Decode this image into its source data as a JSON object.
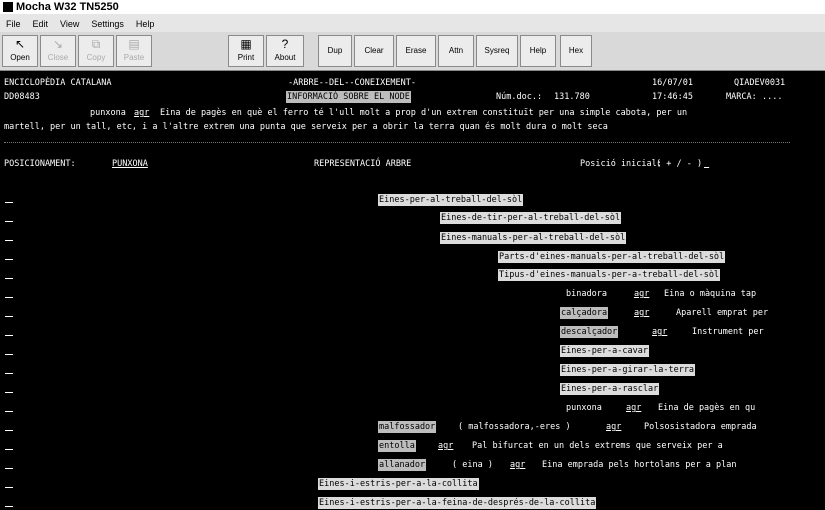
{
  "window": {
    "title": "Mocha W32 TN5250"
  },
  "menu": [
    "File",
    "Edit",
    "View",
    "Settings",
    "Help"
  ],
  "toolbar": {
    "open": "Open",
    "close": "Close",
    "copy": "Copy",
    "paste": "Paste",
    "print": "Print",
    "about": "About",
    "dup": "Dup",
    "clear": "Clear",
    "erase": "Erase",
    "attn": "Attn",
    "sysreq": "Sysreq",
    "help": "Help",
    "hex": "Hex"
  },
  "screen": {
    "header_left": "ENCICLOPÈDIA CATALANA",
    "header_center": "-ARBRE--DEL--CONEIXEMENT-",
    "header_date": "16/07/01",
    "header_code": "QIADEV0031",
    "ws_id": "DD08483",
    "info_title": "INFORMACIÓ SOBRE EL NODE",
    "doc_label": "Núm.doc.:",
    "doc_num": "131.780",
    "time": "17:46:45",
    "marca_label": "MARCA:",
    "marca_value": "....",
    "def_term": "punxona",
    "def_ref": "agr",
    "def_line1": "Eina de pagès en què el ferro té l'ull molt a prop d'un extrem constituït per una simple cabota, per un",
    "def_line2": "martell, per un tall, etc, i a l'altre extrem una punta que serveix per a obrir la terra quan és molt dura o molt seca",
    "pos_label": "POSICIONAMENT:",
    "pos_value": "PUNXONA",
    "repr_label": "REPRESENTACIÓ ARBRE",
    "pos_init_label": "Posició inicial:",
    "pos_init_value": "( + / - )",
    "tree": {
      "n1": "Eines-per-al-treball-del-sòl",
      "n2": "Eines-de-tir-per-al-treball-del-sòl",
      "n3": "Eines-manuals-per-al-treball-del-sòl",
      "n4": "Parts-d'eines-manuals-per-al-treball-del-sòl",
      "n5": "Tipus-d'eines-manuals-per-a-treball-del-sòl",
      "n6_term": "binadora",
      "n6_ref": "agr",
      "n6_def": "Eina o màquina tap",
      "n7_term": "calçadora",
      "n7_ref": "agr",
      "n7_def": "Aparell emprat per",
      "n8_term": "descalçador",
      "n8_ref": "agr",
      "n8_def": "Instrument per",
      "n9": "Eines-per-a-cavar",
      "n10": "Eines-per-a-girar-la-terra",
      "n11": "Eines-per-a-rasclar",
      "n12_term": "punxona",
      "n12_ref": "agr",
      "n12_def": "Eina de pagès en qu",
      "n13_term": "malfossador",
      "n13_mid": "( malfossadora,-eres )",
      "n13_ref": "agr",
      "n13_def": "Polsosistadora emprada",
      "n14_term": "entolla",
      "n14_ref": "agr",
      "n14_def": "Pal bifurcat en un dels extrems que serveix per a",
      "n15_term": "allanador",
      "n15_mid": "( eina )",
      "n15_ref": "agr",
      "n15_def": "Eina emprada pels hortolans per a plan",
      "n16": "Eines-i-estris-per-a-la-collita",
      "n17": "Eines-i-estris-per-a-la-feina-de-després-de-la-collita"
    }
  }
}
